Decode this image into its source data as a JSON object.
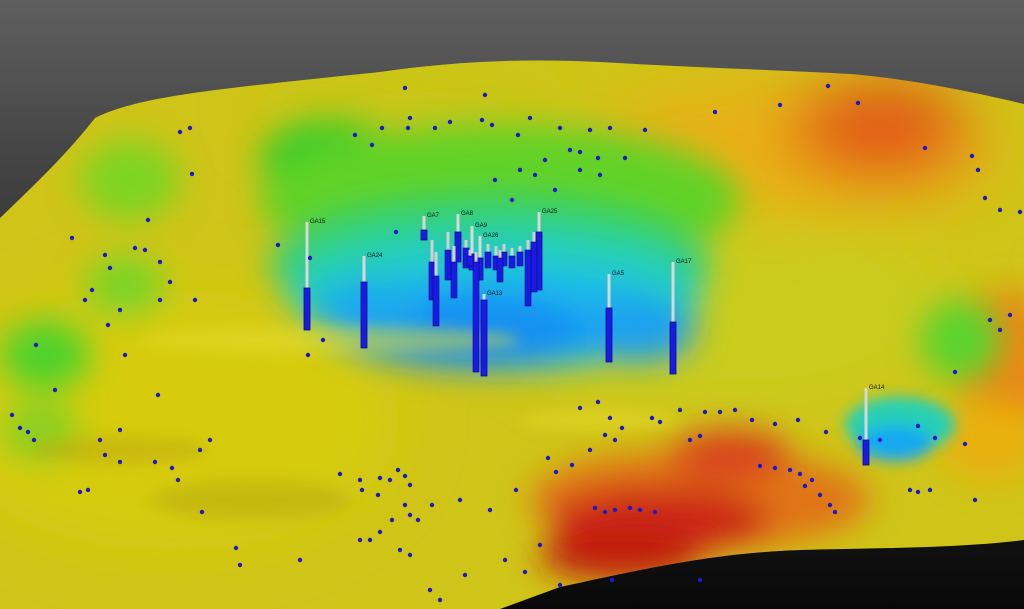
{
  "scene": {
    "title": "",
    "colormap": [
      "#1a1aff",
      "#16a8f5",
      "#22d8c6",
      "#2ed52e",
      "#b8c814",
      "#d4cc08",
      "#e8a010",
      "#e04a12",
      "#c81e12"
    ]
  },
  "wells": [
    {
      "label": "GA15"
    },
    {
      "label": "GA24"
    },
    {
      "label": "GA7"
    },
    {
      "label": "GA8"
    },
    {
      "label": "GA9"
    },
    {
      "label": "GA25"
    },
    {
      "label": "GA26"
    },
    {
      "label": "GA5"
    },
    {
      "label": "GA17"
    },
    {
      "label": "GA13"
    },
    {
      "label": "GA14"
    }
  ]
}
